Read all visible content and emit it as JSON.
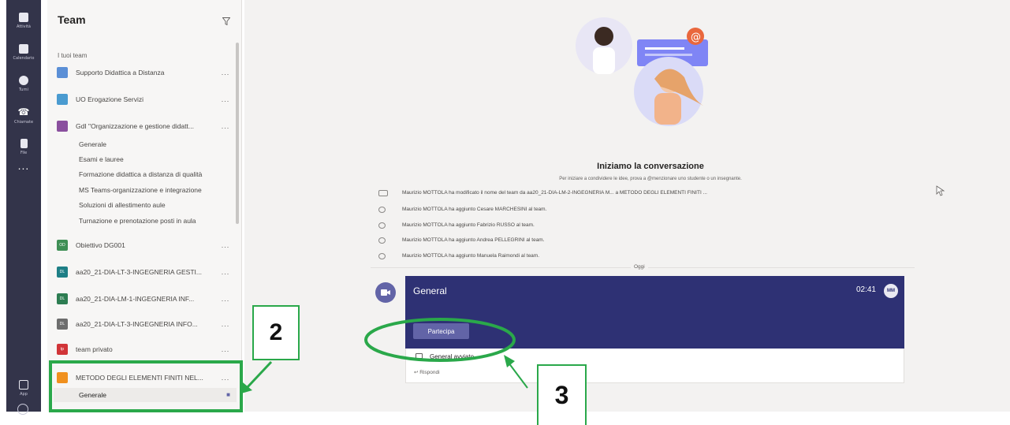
{
  "rail": {
    "items": [
      {
        "label": "Attività",
        "icon": "bell-icon"
      },
      {
        "label": "Calendario",
        "icon": "calendar-icon"
      },
      {
        "label": "Turni",
        "icon": "clock-icon"
      },
      {
        "label": "Chiamate",
        "icon": "phone-icon"
      },
      {
        "label": "File",
        "icon": "file-icon"
      }
    ],
    "more": "...",
    "apps_label": "App"
  },
  "panel": {
    "title": "Team",
    "section_label": "I tuoi team",
    "teams": [
      {
        "name": "Supporto Didattica a Distanza",
        "more": "...",
        "color": "#5b8fd6"
      },
      {
        "name": "UO Erogazione Servizi",
        "more": "...",
        "color": "#4a9bd0"
      },
      {
        "name": "GdI \"Organizzazione e gestione didatt...",
        "more": "...",
        "color": "#8a4f9e"
      },
      {
        "name": "Obiettivo DG001",
        "more": "...",
        "color": "#3f8f55",
        "initials": "OD"
      },
      {
        "name": "aa20_21-DIA-LT-3-INGEGNERIA GESTI...",
        "more": "...",
        "color": "#1e7f86",
        "initials": "DL"
      },
      {
        "name": "aa20_21-DIA-LM-1-INGEGNERIA INF...",
        "more": "...",
        "color": "#2d7d52",
        "initials": "DL"
      },
      {
        "name": "aa20_21-DIA-LT-3-INGEGNERIA INFO...",
        "more": "...",
        "color": "#6d6d6d",
        "initials": "DL"
      },
      {
        "name": "team privato",
        "more": "...",
        "color": "#d13438",
        "initials": "tp"
      },
      {
        "name": "METODO DEGLI ELEMENTI FINITI NEL...",
        "more": "...",
        "color": "#f0901e"
      }
    ],
    "channels_gdi": [
      "Generale",
      "Esami e lauree",
      "Formazione didattica a distanza di qualità",
      "MS Teams-organizzazione e integrazione",
      "Soluzioni di allestimento aule",
      "Turnazione e prenotazione posti in aula"
    ],
    "channel_metodo": "Generale"
  },
  "main": {
    "heading": "Iniziamo la conversazione",
    "subheading": "Per iniziare a condividere le idee, prova a @menzionare uno studente o un insegnante.",
    "activity": [
      "Maurizio MOTTOLA ha modificato il nome del team da aa20_21-DIA-LM-2-INGEGNERIA M... a METODO DEGLI ELEMENTI FINITI ...",
      "Maurizio MOTTOLA ha aggiunto Cesare MARCHESINI al team.",
      "Maurizio MOTTOLA ha aggiunto Fabrizio RUSSO al team.",
      "Maurizio MOTTOLA ha aggiunto Andrea PELLEGRINI al team.",
      "Maurizio MOTTOLA ha aggiunto Manuela Raimondi al team."
    ],
    "divider_label": "Oggi",
    "meeting": {
      "title": "General",
      "time": "02:41",
      "initials": "MM",
      "join_label": "Partecipa",
      "started_label": "General avviato",
      "reply_label": "Rispondi"
    }
  },
  "annotations": {
    "label2": "2",
    "label3": "3",
    "color": "#2aa84a"
  }
}
